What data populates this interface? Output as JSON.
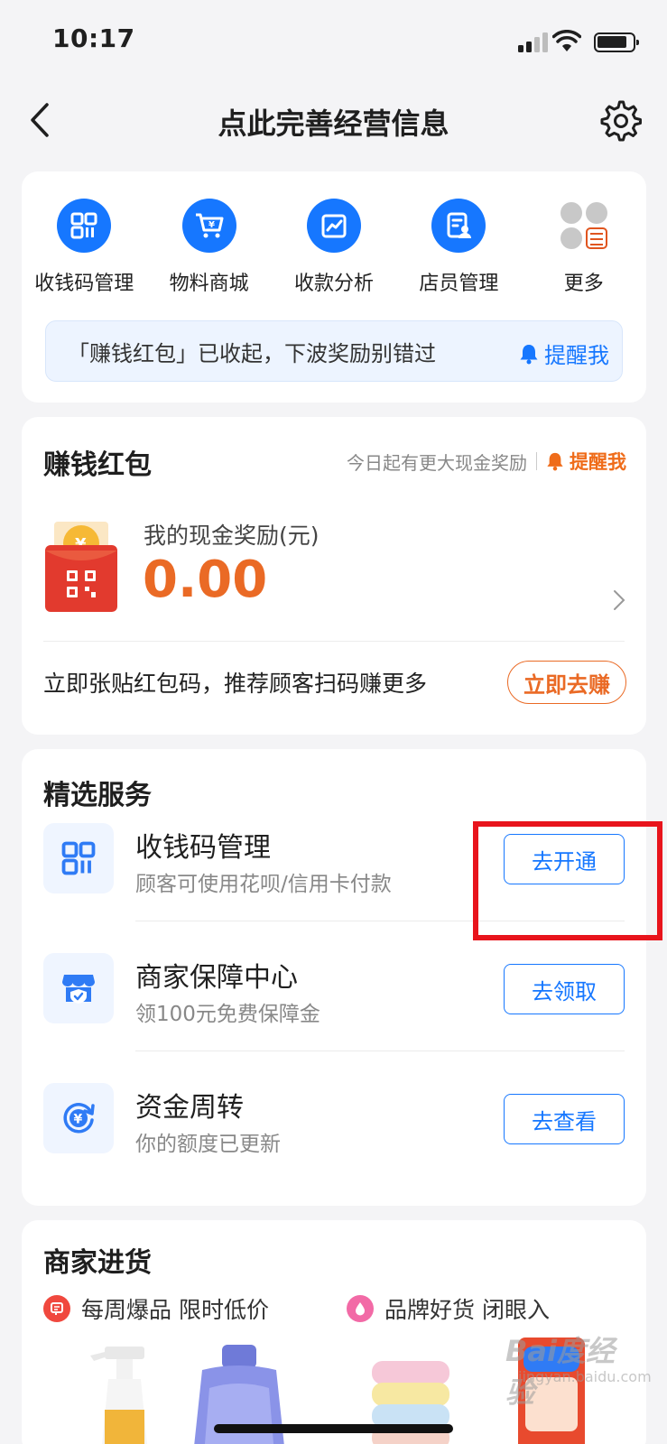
{
  "status_bar": {
    "time": "10:17"
  },
  "nav": {
    "title": "点此完善经营信息"
  },
  "quick_actions": [
    {
      "label": "收钱码管理",
      "icon": "qr-code-icon"
    },
    {
      "label": "物料商城",
      "icon": "shopping-cart-icon"
    },
    {
      "label": "收款分析",
      "icon": "chart-icon"
    },
    {
      "label": "店员管理",
      "icon": "staff-icon"
    },
    {
      "label": "更多",
      "icon": "more-grid-icon"
    }
  ],
  "notice": {
    "text": "「赚钱红包」已收起，下波奖励别错过",
    "remind_label": "提醒我"
  },
  "red_packet": {
    "title": "赚钱红包",
    "subtitle": "今日起有更大现金奖励",
    "remind_label": "提醒我",
    "reward_label": "我的现金奖励(元)",
    "amount": "0.00",
    "promo_text": "立即张贴红包码，推荐顾客扫码赚更多",
    "earn_button": "立即去赚"
  },
  "services": {
    "title": "精选服务",
    "items": [
      {
        "name": "收钱码管理",
        "desc": "顾客可使用花呗/信用卡付款",
        "button": "去开通"
      },
      {
        "name": "商家保障中心",
        "desc": "领100元免费保障金",
        "button": "去领取"
      },
      {
        "name": "资金周转",
        "desc": "你的额度已更新",
        "button": "去查看"
      }
    ]
  },
  "stock": {
    "title": "商家进货",
    "tags": [
      {
        "label": "每周爆品 限时低价",
        "color": "#f0483e"
      },
      {
        "label": "品牌好货 闭眼入",
        "color": "#f26aa6"
      }
    ]
  },
  "watermark": {
    "brand": "Bai度经验",
    "url": "jingyan.baidu.com"
  },
  "colors": {
    "accent": "#1677ff",
    "orange": "#ea6a25",
    "highlight": "#e8141c"
  }
}
